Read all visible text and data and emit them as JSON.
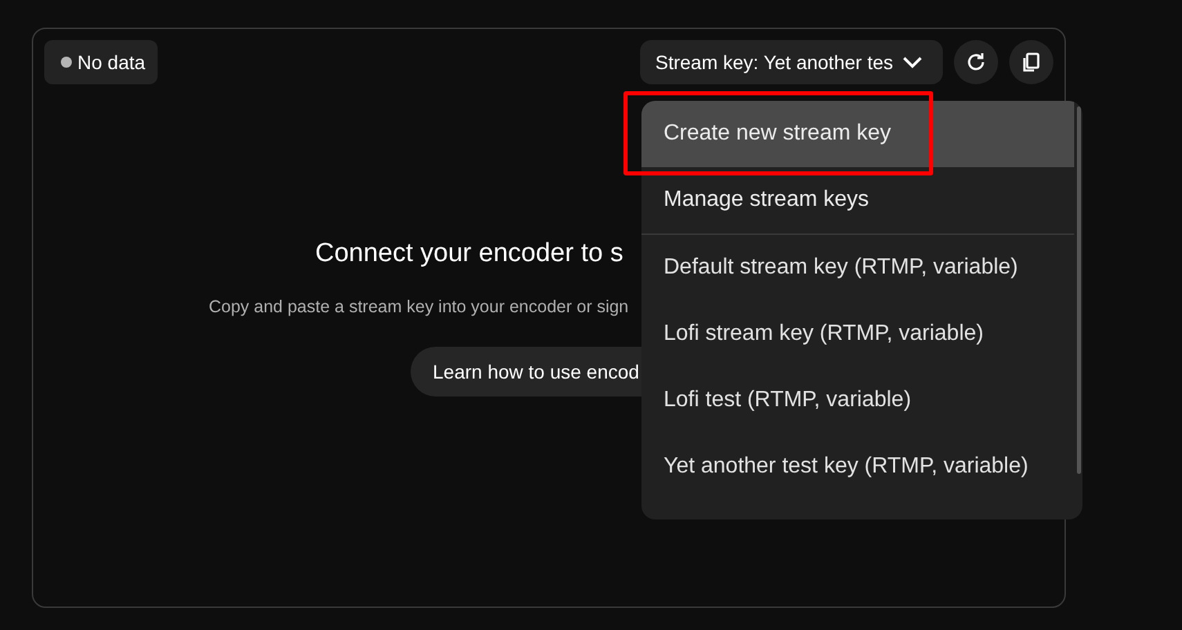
{
  "status_badge": {
    "label": "No data",
    "color": "#b5b5b5"
  },
  "stream_key_select": {
    "label": "Stream key: Yet another tes"
  },
  "toolbar": [
    {
      "kind": "refresh"
    },
    {
      "kind": "copy"
    }
  ],
  "empty_state": {
    "title": "Connect your encoder to s",
    "subtitle": "Copy and paste a stream key into your encoder or sign",
    "button": "Learn how to use encod"
  },
  "menu": {
    "items": [
      {
        "label": "Create new stream key",
        "kind": "action",
        "selected": true
      },
      {
        "label": "Manage stream keys",
        "kind": "action",
        "selected": false
      },
      {
        "label": "Default stream key (RTMP, variable)",
        "kind": "key",
        "selected": false
      },
      {
        "label": "Lofi stream key (RTMP, variable)",
        "kind": "key",
        "selected": false
      },
      {
        "label": "Lofi test (RTMP, variable)",
        "kind": "key",
        "selected": false
      },
      {
        "label": "Yet another test key (RTMP, variable)",
        "kind": "key",
        "selected": false
      }
    ]
  }
}
